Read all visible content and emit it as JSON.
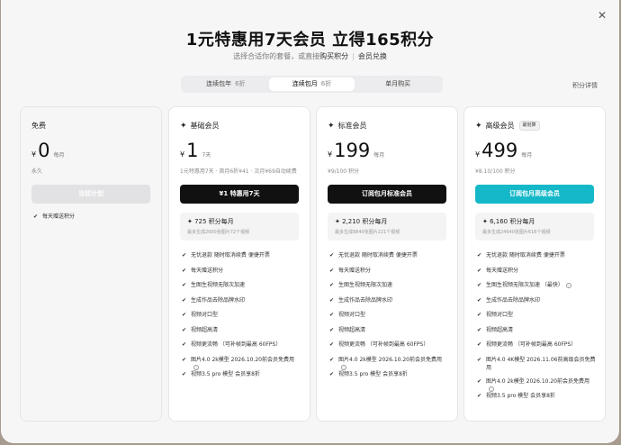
{
  "header": {
    "title": "1元特惠用7天会员 立得165积分",
    "subtitle_prefix": "选择合适你的套餐，或直接",
    "buy_credits_link": "购买积分",
    "separator": "|",
    "redeem_link": "会员兑换"
  },
  "tabs": [
    {
      "label": "连续包年",
      "discount": "6折",
      "active": false
    },
    {
      "label": "连续包月",
      "discount": "6折",
      "active": true
    },
    {
      "label": "单月购买",
      "discount": "",
      "active": false
    }
  ],
  "credit_details_link": "积分详情",
  "plans": [
    {
      "name": "免费",
      "currency": "¥",
      "price": "0",
      "unit": "每月",
      "note": "永久",
      "cta": "当前计划",
      "features": [
        "每天赠送积分"
      ]
    },
    {
      "name": "基础会员",
      "currency": "¥",
      "price": "1",
      "unit": "7天",
      "note": "1元特惠用7天 · 首月6折¥41 · 次月¥69自动续费",
      "cta": "¥1 特惠用7天",
      "credits": "725 积分每月",
      "credits_sub": "最多生成2900张图片72个视频",
      "features": [
        "无忧退款 随时取消续费 便捷开票",
        "每天赠送积分",
        "生图生视频无限次加速",
        "生成作品去除品牌水印",
        "视频对口型",
        "视频超高清",
        "视频更流畅 （可补帧到最高 60FPS）",
        "图片4.0 2k模型 2026.10.20前会员免费用",
        "视频3.5 pro 模型 会员享8折"
      ]
    },
    {
      "name": "标准会员",
      "currency": "¥",
      "price": "199",
      "unit": "每月",
      "note": "¥9/100 积分",
      "cta": "订阅包月标准会员",
      "credits": "2,210 积分每月",
      "credits_sub": "最多生成8840张图片221个视频",
      "features": [
        "无忧退款 随时取消续费 便捷开票",
        "每天赠送积分",
        "生图生视频无限次加速",
        "生成作品去除品牌水印",
        "视频对口型",
        "视频超高清",
        "视频更流畅 （可补帧到最高 60FPS）",
        "图片4.0 2k模型 2026.10.20前会员免费用",
        "视频3.5 pro 模型 会员享8折"
      ]
    },
    {
      "name": "高级会员",
      "badge": "最划算",
      "currency": "¥",
      "price": "499",
      "unit": "每月",
      "note": "¥8.10/100 积分",
      "cta": "订阅包月高级会员",
      "credits": "6,160 积分每月",
      "credits_sub": "最多生成24640张图片616个视频",
      "features": [
        "无忧退款 随时取消续费 便捷开票",
        "每天赠送积分",
        "生图生视频无限次加速 （最快）",
        "生成作品去除品牌水印",
        "视频对口型",
        "视频超高清",
        "视频更流畅 （可补帧到最高 60FPS）",
        "图片4.0 4K模型 2026.11.06前高级会员免费用",
        "图片4.0 2k模型 2026.10.20前会员免费用",
        "视频3.5 pro 模型 会员享8折"
      ]
    }
  ],
  "icons": {
    "close": "close-icon",
    "check": "check-icon",
    "sparkle": "sparkle-icon",
    "info": "info-icon"
  },
  "colors": {
    "teal_cta": "#14b8c8",
    "black_cta": "#111111",
    "disabled_cta": "#e2e2e4"
  }
}
